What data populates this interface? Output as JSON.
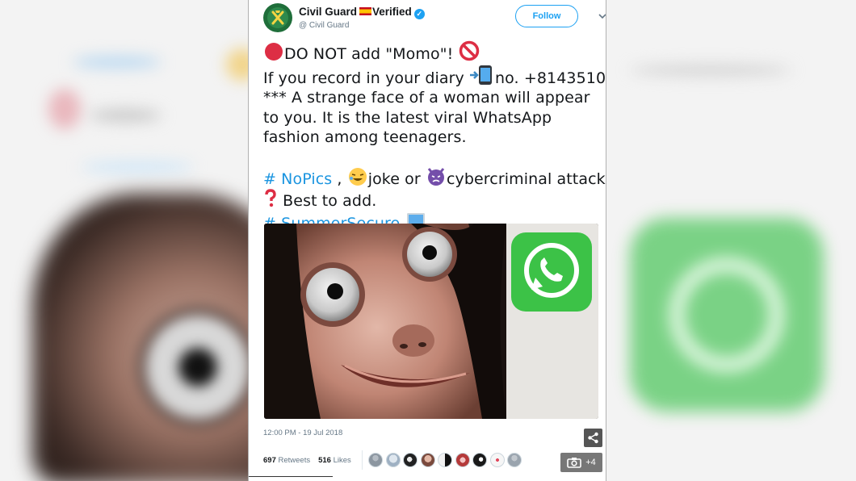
{
  "account": {
    "name": "Civil Guard",
    "verified_label": "Verified",
    "handle": "@ Civil Guard",
    "follow_label": "Follow"
  },
  "tweet": {
    "line1": "DO NOT add \"Momo\"!",
    "line2_a": "If you record in your diary",
    "line2_b": "no. +8143510",
    "line3": "*** A strange face of a woman will appear to you. It is the latest viral WhatsApp fashion among teenagers.",
    "hashtag1": "# NoPics",
    "line5_a": ",",
    "line5_b": "joke or",
    "line5_c": "cybercriminal attack",
    "line6": "Best to add.",
    "hashtag2": "# SummerSecure"
  },
  "meta": {
    "timestamp": "12:00 PM - 19 Jul 2018",
    "retweets_count": "697",
    "retweets_label": "Retweets",
    "likes_count": "516",
    "likes_label": "Likes",
    "more_photos_label": "+4"
  },
  "colors": {
    "link": "#1b95e0",
    "follow_border": "#1da1f2",
    "whatsapp_green": "#3cc247"
  }
}
